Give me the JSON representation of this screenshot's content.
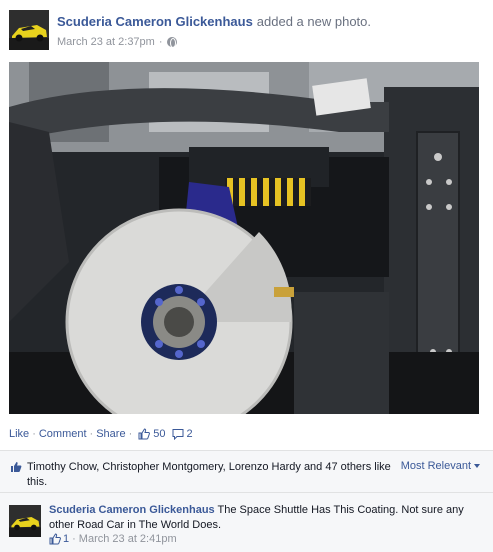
{
  "post": {
    "author": "Scuderia Cameron Glickenhaus",
    "action": "added a new photo.",
    "timestamp": "March 23 at 2:37pm",
    "meta_separator": "·"
  },
  "actions": {
    "like": "Like",
    "comment": "Comment",
    "share": "Share",
    "separator": "·",
    "like_count": "50",
    "comment_count": "2"
  },
  "likes": {
    "text": "Timothy Chow, Christopher Montgomery, Lorenzo Hardy and 47 others like this.",
    "sort_label": "Most Relevant"
  },
  "comment": {
    "author": "Scuderia Cameron Glickenhaus",
    "text": "The Space Shuttle Has This Coating. Not sure any other Road Car in The World Does.",
    "like_count": "1",
    "separator": "·",
    "timestamp": "March 23 at 2:41pm"
  },
  "colors": {
    "link": "#3b5998",
    "meta": "#90949c",
    "panel": "#f6f7f9"
  }
}
